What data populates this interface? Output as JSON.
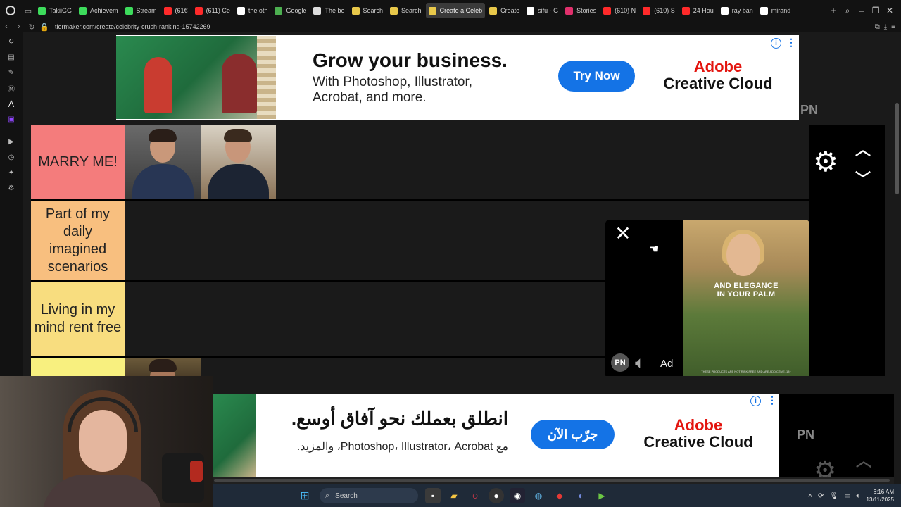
{
  "browser": {
    "tabs": [
      {
        "title": "TakiiGG",
        "color": "#3ddc5c"
      },
      {
        "title": "Achievem",
        "color": "#3ddc5c"
      },
      {
        "title": "Stream",
        "color": "#3ddc5c"
      },
      {
        "title": "(61€",
        "color": "#ff2a2a"
      },
      {
        "title": "(611) Ce",
        "color": "#ff2a2a"
      },
      {
        "title": "the oth",
        "color": "#ffffff"
      },
      {
        "title": "Google",
        "color": "#4caf50"
      },
      {
        "title": "The be",
        "color": "#dddddd"
      },
      {
        "title": "Search",
        "color": "#e8c84a"
      },
      {
        "title": "Search",
        "color": "#e8c84a"
      },
      {
        "title": "Create a Celeb",
        "color": "#e8c84a",
        "active": true
      },
      {
        "title": "Create",
        "color": "#e8c84a"
      },
      {
        "title": "sifu - G",
        "color": "#ffffff"
      },
      {
        "title": "Stories",
        "color": "#e1306c"
      },
      {
        "title": "(610) N",
        "color": "#ff2a2a"
      },
      {
        "title": "(610) S",
        "color": "#ff2a2a"
      },
      {
        "title": "24 Hou",
        "color": "#ff2a2a"
      },
      {
        "title": "ray ban",
        "color": "#ffffff"
      },
      {
        "title": "mirand",
        "color": "#ffffff"
      }
    ],
    "new_tab": "+",
    "url": "tiermaker.com/create/celebrity-crush-ranking-15742269"
  },
  "ad_top": {
    "headline": "Grow your business.",
    "sub_line1": "With Photoshop, Illustrator,",
    "sub_line2": "Acrobat, and more.",
    "button": "Try Now",
    "brand1": "Adobe",
    "brand2": "Creative Cloud",
    "info": "i",
    "pn": "PN"
  },
  "tiers": [
    {
      "label": "MARRY ME!",
      "color": "#f47c7c"
    },
    {
      "label": "Part of my daily imagined scenarios",
      "color": "#f8bf7f"
    },
    {
      "label": "Living in my mind rent free",
      "color": "#f8dd7f"
    },
    {
      "label": "",
      "color": "#f8f07f"
    }
  ],
  "float_ad": {
    "caption1": "AND ELEGANCE",
    "caption2": "IN YOUR PALM",
    "fine_print": "THESE PRODUCTS ARE NOT RISK-FREE AND ARE ADDICTIVE. 18+",
    "pn": "PN",
    "ad_label": "Ad"
  },
  "ad_bottom": {
    "headline": "انطلق بعملك نحو آفاق أوسع.",
    "sub": "مع Photoshop، Illustrator، Acrobat، والمزيد.",
    "button": "جرّب الآن",
    "brand1": "Adobe",
    "brand2": "Creative Cloud",
    "pn": "PN"
  },
  "taskbar": {
    "search": "Search",
    "time": "6:16 AM",
    "date": "13/11/2025"
  }
}
